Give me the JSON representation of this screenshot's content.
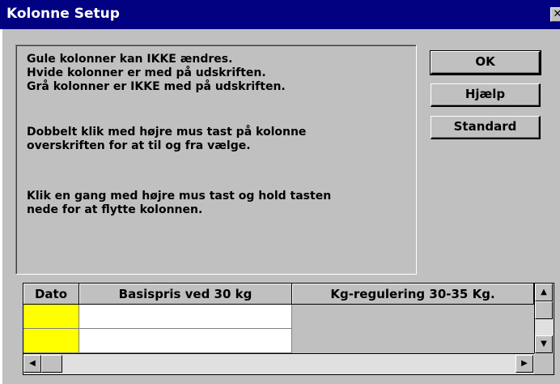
{
  "window": {
    "title": "Kolonne Setup",
    "close_glyph": "✕"
  },
  "info": {
    "paragraph1": "Gule kolonner kan IKKE ændres.\nHvide kolonner er med på udskriften.\nGrå kolonner er IKKE med på udskriften.",
    "paragraph2": "Dobbelt klik med højre mus tast på kolonne\noverskriften for at til og fra vælge.",
    "paragraph3": "Klik en gang med højre mus tast og hold tasten\nnede for at flytte kolonnen."
  },
  "buttons": {
    "ok": "OK",
    "help": "Hjælp",
    "standard": "Standard"
  },
  "grid": {
    "columns": [
      "Dato",
      "Basispris ved 30 kg",
      "Kg-regulering 30-35 Kg."
    ],
    "column_colors": [
      "#ffff00",
      "#ffffff",
      "#c0c0c0"
    ],
    "row_count": 2
  },
  "scroll": {
    "up_icon": "▲",
    "down_icon": "▼",
    "left_icon": "◀",
    "right_icon": "▶"
  }
}
